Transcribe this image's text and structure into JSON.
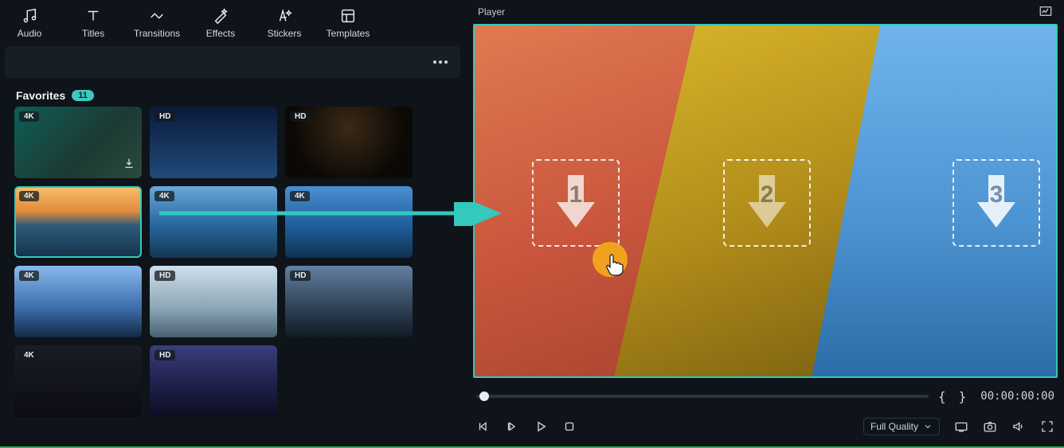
{
  "colors": {
    "accent": "#33c9bd",
    "green_line": "#2bb54a",
    "highlight": "#f0a21e"
  },
  "toolbar": {
    "audio": "Audio",
    "titles": "Titles",
    "transitions": "Transitions",
    "effects": "Effects",
    "stickers": "Stickers",
    "templates": "Templates"
  },
  "section": {
    "title": "Favorites",
    "count": "11"
  },
  "thumbs": [
    {
      "quality": "4K",
      "download": true,
      "selected": false
    },
    {
      "quality": "HD",
      "download": false,
      "selected": false
    },
    {
      "quality": "HD",
      "download": false,
      "selected": false
    },
    {
      "quality": "4K",
      "download": false,
      "selected": true
    },
    {
      "quality": "4K",
      "download": false,
      "selected": false
    },
    {
      "quality": "4K",
      "download": false,
      "selected": false
    },
    {
      "quality": "4K",
      "download": false,
      "selected": false
    },
    {
      "quality": "HD",
      "download": false,
      "selected": false
    },
    {
      "quality": "HD",
      "download": false,
      "selected": false
    },
    {
      "quality": "4K",
      "download": false,
      "selected": false
    },
    {
      "quality": "HD",
      "download": false,
      "selected": false
    }
  ],
  "player": {
    "title": "Player",
    "drop_labels": [
      "1",
      "2",
      "3"
    ],
    "timecode": "00:00:00:00",
    "brace_open": "{",
    "brace_close": "}",
    "quality_label": "Full Quality"
  }
}
